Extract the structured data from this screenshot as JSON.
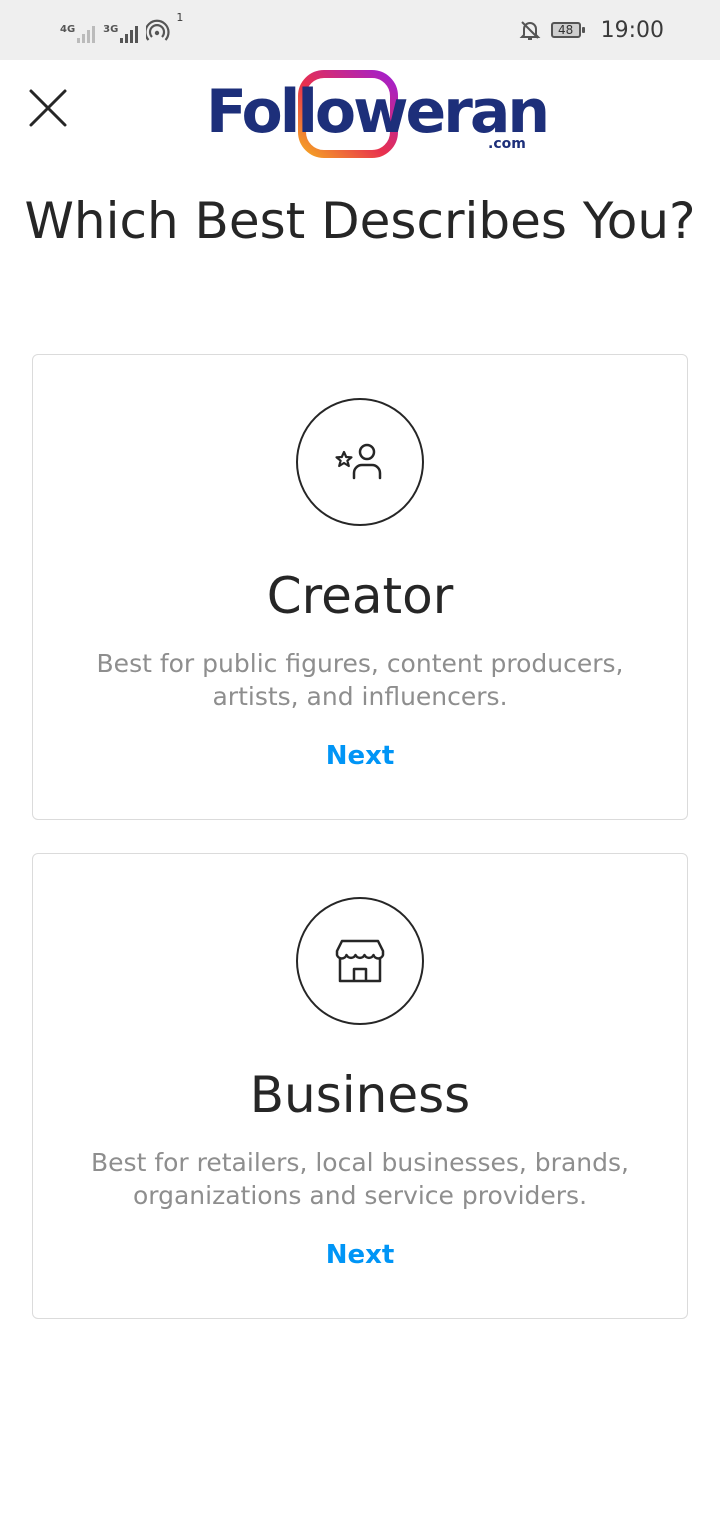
{
  "status_bar": {
    "network_1": "4G",
    "network_2": "3G",
    "hotspot_count": "1",
    "battery": "48",
    "time": "19:00"
  },
  "header": {
    "logo_text": "Followeran",
    "logo_domain": ".com"
  },
  "page": {
    "title": "Which Best Describes You?"
  },
  "cards": [
    {
      "title": "Creator",
      "description": "Best for public figures, content producers, artists, and influencers.",
      "action": "Next",
      "icon": "creator-icon"
    },
    {
      "title": "Business",
      "description": "Best for retailers, local businesses, brands, organizations and service providers.",
      "action": "Next",
      "icon": "shop-icon"
    }
  ],
  "colors": {
    "link": "#0095f6",
    "text_primary": "#262626",
    "text_secondary": "#8e8e8e",
    "card_border": "#dbdbdb",
    "logo_blue": "#1d2f7a"
  }
}
